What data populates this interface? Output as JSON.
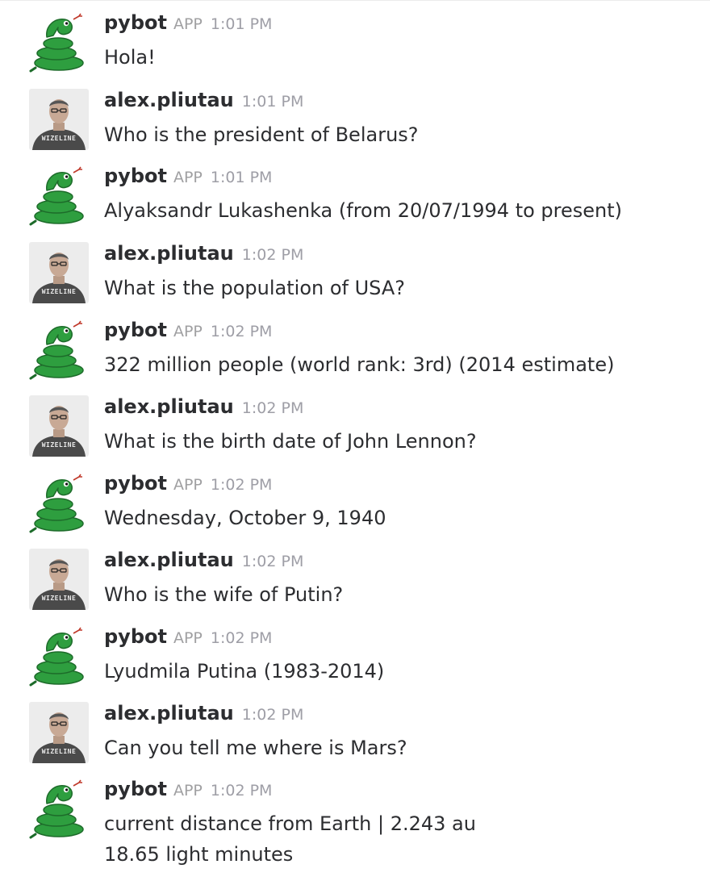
{
  "messages": [
    {
      "author": "pybot",
      "badge": "APP",
      "time": "1:01 PM",
      "lines": [
        "Hola!"
      ]
    },
    {
      "author": "alex.pliutau",
      "time": "1:01 PM",
      "avatar_shirt_text": "WIZELINE",
      "lines": [
        "Who is the president of Belarus?"
      ]
    },
    {
      "author": "pybot",
      "badge": "APP",
      "time": "1:01 PM",
      "lines": [
        "Alyaksandr Lukashenka  (from 20/07/1994  to  present)"
      ]
    },
    {
      "author": "alex.pliutau",
      "time": "1:02 PM",
      "avatar_shirt_text": "WIZELINE",
      "lines": [
        "What is the population of USA?"
      ]
    },
    {
      "author": "pybot",
      "badge": "APP",
      "time": "1:02 PM",
      "lines": [
        "322 million people  (world rank: 3rd)  (2014 estimate)"
      ]
    },
    {
      "author": "alex.pliutau",
      "time": "1:02 PM",
      "avatar_shirt_text": "WIZELINE",
      "lines": [
        "What is the birth date of John Lennon?"
      ]
    },
    {
      "author": "pybot",
      "badge": "APP",
      "time": "1:02 PM",
      "lines": [
        "Wednesday, October 9, 1940"
      ]
    },
    {
      "author": "alex.pliutau",
      "time": "1:02 PM",
      "avatar_shirt_text": "WIZELINE",
      "lines": [
        "Who is the wife of Putin?"
      ]
    },
    {
      "author": "pybot",
      "badge": "APP",
      "time": "1:02 PM",
      "lines": [
        "Lyudmila Putina  (1983-2014)"
      ]
    },
    {
      "author": "alex.pliutau",
      "time": "1:02 PM",
      "avatar_shirt_text": "WIZELINE",
      "lines": [
        "Can you tell me where is Mars?"
      ]
    },
    {
      "author": "pybot",
      "badge": "APP",
      "time": "1:02 PM",
      "lines": [
        "current distance from Earth | 2.243 au",
        "18.65 light minutes"
      ]
    }
  ],
  "icons": {
    "bot_avatar": "snake-icon",
    "user_avatar": "user-photo"
  },
  "colors": {
    "snake_green": "#2e9e3f",
    "author_text": "#2c2d30",
    "meta_text": "#9e9ea6"
  }
}
